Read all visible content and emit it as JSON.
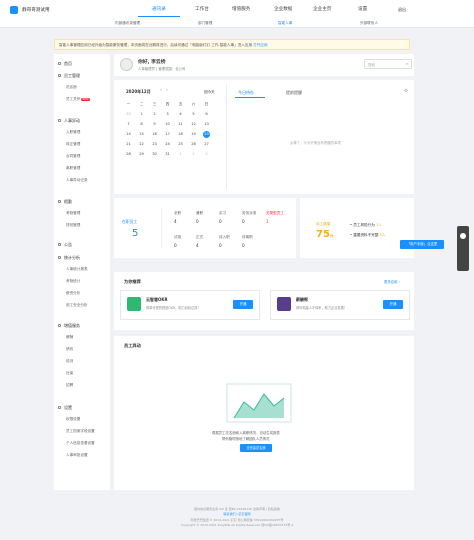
{
  "header": {
    "app_title": "静哥哥测试用",
    "nav": [
      "通讯录",
      "工作台",
      "增值服务",
      "企业数据",
      "企业主页",
      "设置"
    ],
    "logout": "退出",
    "subnav": [
      "内部通讯录管理",
      "部门管理",
      "智能人事",
      "外部联系人"
    ]
  },
  "notice": {
    "text": "智能人事管理应用已经升级为智能服务管理，本页面将在近期将进行，后续可通过「电脑版钉钉-工作-智能人事」进入应用",
    "link": "打开应用"
  },
  "sidebar": {
    "home": "首页",
    "groups": [
      {
        "title": "员工管理",
        "items": [
          "花名册",
          "员工关怀"
        ],
        "badge": "NEW"
      },
      {
        "title": "人事异动",
        "items": [
          "入职管理",
          "转正管理",
          "合同管理",
          "离职管理",
          "人事异动记录"
        ]
      },
      {
        "title": "假勤",
        "items": [
          "考勤管理",
          "排班管理"
        ]
      },
      {
        "title": "公告",
        "items": []
      },
      {
        "title": "统计分析",
        "items": [
          "人事统计报表",
          "考勤统计",
          "薪资分析",
          "用工安全分析"
        ]
      },
      {
        "title": "增值服务",
        "items": [
          "薪酬",
          "绩效",
          "培训",
          "社保",
          "招聘"
        ]
      },
      {
        "title": "设置",
        "items": [
          "权限设置",
          "员工档案字段设置",
          "个人信息查看设置",
          "人事审批设置"
        ]
      }
    ]
  },
  "profile": {
    "greeting": "你好,",
    "name": "李云桥",
    "role": "人事管理员",
    "dept": "管理范围：全公司"
  },
  "search": {
    "placeholder": "搜索"
  },
  "calendar": {
    "month": "2020年12月",
    "today_btn": "回今天",
    "weekdays": [
      "一",
      "二",
      "三",
      "四",
      "五",
      "六",
      "日"
    ],
    "rows": [
      [
        "30",
        "1",
        "2",
        "3",
        "4",
        "5",
        "6"
      ],
      [
        "7",
        "8",
        "9",
        "10",
        "11",
        "12",
        "13"
      ],
      [
        "14",
        "15",
        "16",
        "17",
        "18",
        "19",
        "20"
      ],
      [
        "21",
        "22",
        "23",
        "24",
        "25",
        "26",
        "27"
      ],
      [
        "28",
        "29",
        "30",
        "31",
        "1",
        "2",
        "3"
      ]
    ],
    "today": "20"
  },
  "todo": {
    "tabs": [
      "今日待办",
      "提前提醒"
    ],
    "empty": "太棒了，今天好像没有提醒的事项"
  },
  "stats": {
    "total_label": "在职员工",
    "total": "5",
    "items": [
      {
        "label": "全职",
        "value": "4"
      },
      {
        "label": "兼职",
        "value": "0"
      },
      {
        "label": "实习",
        "value": "0"
      },
      {
        "label": "劳务派遣",
        "value": "0"
      },
      {
        "label": "无类型员工",
        "value": "1"
      },
      {
        "label": "试用",
        "value": "0"
      },
      {
        "label": "正式",
        "value": "4"
      },
      {
        "label": "待入职",
        "value": "0"
      },
      {
        "label": "待离职",
        "value": "0"
      }
    ]
  },
  "score": {
    "label": "用工健康",
    "value": "75",
    "unit": "分",
    "risk_label": "员工风险行为",
    "risk_value": "1人",
    "info_label": "重要资料不完整",
    "info_value": "5人"
  },
  "float": {
    "label": "「用户手册」点这里"
  },
  "recommend": {
    "title": "为你推荐",
    "more": "更多应用 ›",
    "apps": [
      {
        "name": "云智慧OKR",
        "desc": "简单可视的规划OKR，助力目标达成！",
        "btn": "开通",
        "color": "#2eb872"
      },
      {
        "name": "薪酬帮",
        "desc": "帮你构建人才体系，助力企业发展！",
        "btn": "开通",
        "color": "#5a3d8c"
      }
    ]
  },
  "activity": {
    "title": "员工异动",
    "desc1": "根据员工花名册和入离职情况，自动生成报表",
    "desc2": "帮你随时随地了解团队人员情况",
    "btn": "去完善花名册"
  },
  "footer": {
    "line1": "国内信息服务业务 ICP 证 浙B2-20190136 法律声明 | 隐私政策",
    "line2": "阿里巴巴集团 © 2014-2021 钉钉 浙公网安备 33010602009975号",
    "line3": "Copyright © 2014-2021 DingTalk All Rights Reserved 浙ICP备18037475号-4",
    "links": "联系我们 | 钉钉官网"
  }
}
